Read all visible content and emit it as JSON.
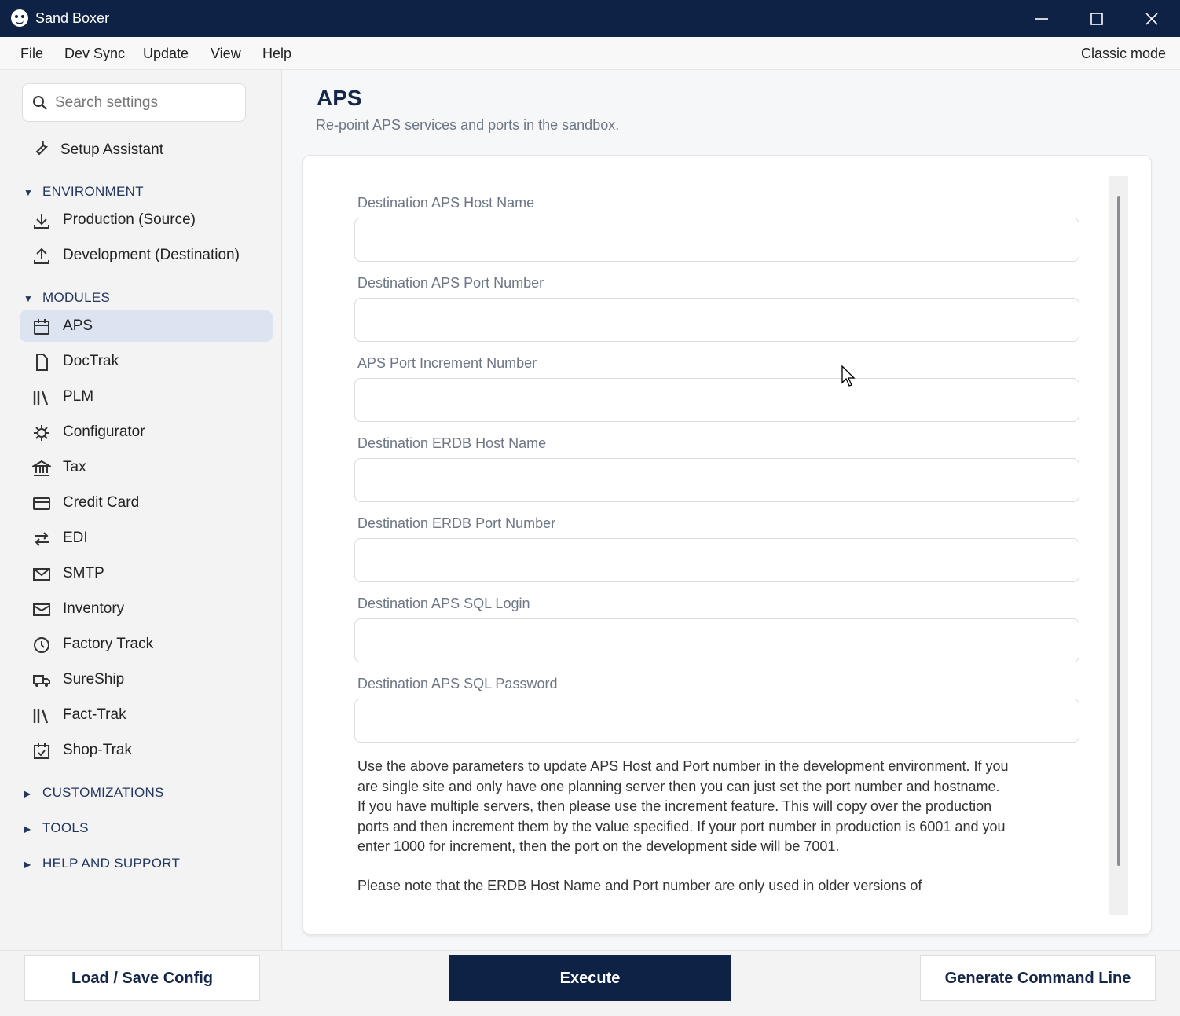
{
  "window": {
    "title": "Sand Boxer"
  },
  "menu": {
    "items": [
      "File",
      "Dev Sync",
      "Update",
      "View",
      "Help"
    ],
    "classic_mode": "Classic mode"
  },
  "sidebar": {
    "search_placeholder": "Search settings",
    "setup_assistant": "Setup Assistant",
    "environment": {
      "title": "ENVIRONMENT",
      "items": [
        "Production (Source)",
        "Development (Destination)"
      ]
    },
    "modules": {
      "title": "MODULES",
      "items": [
        "APS",
        "DocTrak",
        "PLM",
        "Configurator",
        "Tax",
        "Credit Card",
        "EDI",
        "SMTP",
        "Inventory",
        "Factory Track",
        "SureShip",
        "Fact-Trak",
        "Shop-Trak"
      ],
      "selected": "APS"
    },
    "collapsed_sections": [
      "CUSTOMIZATIONS",
      "TOOLS",
      "HELP AND SUPPORT"
    ]
  },
  "page": {
    "title": "APS",
    "subtitle": "Re-point APS services and ports in the sandbox.",
    "fields": [
      {
        "label": "Destination APS Host Name",
        "value": ""
      },
      {
        "label": "Destination APS Port Number",
        "value": ""
      },
      {
        "label": "APS Port Increment Number",
        "value": ""
      },
      {
        "label": "Destination ERDB Host Name",
        "value": ""
      },
      {
        "label": "Destination ERDB Port Number",
        "value": ""
      },
      {
        "label": "Destination APS SQL Login",
        "value": ""
      },
      {
        "label": "Destination APS SQL Password",
        "value": ""
      }
    ],
    "help_text": "Use the above parameters to update APS Host and Port number in the development environment. If you are single site and only have one planning server then you can just set the port number and hostname. If you have multiple servers, then please use the increment feature. This will copy over the production ports and then increment them by the value specified. If your port number in production is 6001 and you enter 1000 for increment, then the port on the development side will be 7001.",
    "help_text_2": "Please note that the ERDB Host Name and Port number are only used in older versions of"
  },
  "footer": {
    "load_save": "Load / Save Config",
    "execute": "Execute",
    "generate": "Generate Command Line"
  },
  "colors": {
    "titlebar": "#0e2246",
    "accent": "#16284a",
    "selected_row": "#dde4f1"
  }
}
